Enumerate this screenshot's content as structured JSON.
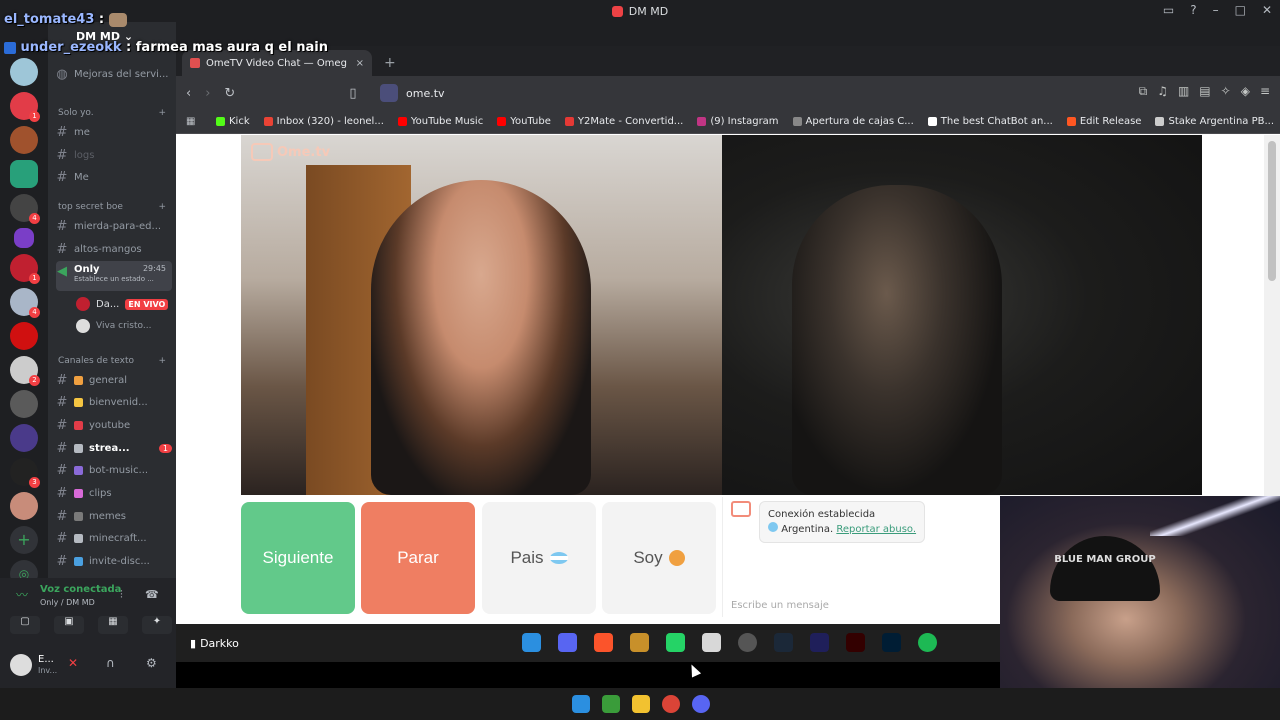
{
  "discord": {
    "window_title": "DM MD",
    "guild_name": "DM MD",
    "top_item": "Mejoras del servi...",
    "categories": [
      {
        "label": "Solo yo.",
        "channels": [
          "me",
          "logs",
          "Me"
        ]
      },
      {
        "label": "top secret boe",
        "channels": [
          "mierda-para-ed...",
          "altos-mangos"
        ]
      }
    ],
    "voice_channel": {
      "name": "Only",
      "time": "29:45",
      "status": "Establece un estado ...",
      "users": [
        {
          "name": "Da...",
          "badge": "EN VIVO"
        },
        {
          "name": "Viva cristo..."
        }
      ]
    },
    "text_category": "Canales de texto",
    "text_channels": [
      {
        "label": "general"
      },
      {
        "label": "bienvenid..."
      },
      {
        "label": "youtube"
      },
      {
        "label": "strea...",
        "badge": "1"
      },
      {
        "label": "bot-music..."
      },
      {
        "label": "clips"
      },
      {
        "label": "memes"
      },
      {
        "label": "minecraft..."
      },
      {
        "label": "invite-disc..."
      }
    ],
    "voice_panel": {
      "status": "Voz conectada",
      "location": "Only / DM MD",
      "user_initial": "E...",
      "user_sub": "Inv..."
    }
  },
  "chat_overlay": [
    {
      "user": "el_tomate43",
      "sep": " :",
      "message": ""
    },
    {
      "user": "under_ezeokk",
      "sep": " :",
      "message": " farmea mas aura q el nain"
    }
  ],
  "browser": {
    "tab_title": "OmeTV Video Chat — Omeg",
    "tab_close": "×",
    "new_tab": "+",
    "url": "ome.tv",
    "bookmarks": [
      {
        "label": "Kick",
        "color": "#53fc18"
      },
      {
        "label": "Inbox (320) - leonel...",
        "color": "#ea4335"
      },
      {
        "label": "YouTube Music",
        "color": "#ff0000"
      },
      {
        "label": "YouTube",
        "color": "#ff0000"
      },
      {
        "label": "Y2Mate - Convertid...",
        "color": "#e53935"
      },
      {
        "label": "(9) Instagram",
        "color": "#c13584"
      },
      {
        "label": "Apertura de cajas C...",
        "color": "#888888"
      },
      {
        "label": "The best ChatBot an...",
        "color": "#ffffff"
      },
      {
        "label": "Edit Release",
        "color": "#ff5722"
      },
      {
        "label": "Stake Argentina PB...",
        "color": "#cccccc"
      }
    ]
  },
  "ometv": {
    "logo": "Ome.tv",
    "buttons": {
      "next": "Siguiente",
      "stop": "Parar",
      "country": "Pais",
      "gender": "Soy"
    },
    "system_message": {
      "line1": "Conexión establecida",
      "country": "Argentina.",
      "report": "Reportar abuso."
    },
    "input_placeholder": "Escribe un mensaje"
  },
  "inner_taskbar": {
    "user": "Darkko"
  },
  "webcam": {
    "beanie_text": "BLUE MAN GROUP"
  }
}
